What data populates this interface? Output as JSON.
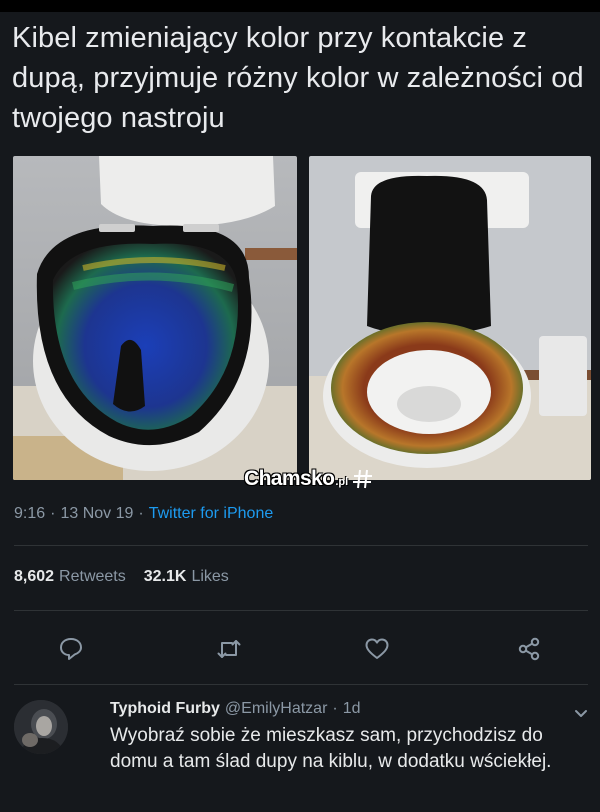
{
  "tweet": {
    "text": "Kibel zmieniający kolor przy kontakcie z dupą, przyjmuje różny kolor w zależności od twojego nastroju"
  },
  "watermark": {
    "main": "Chamsko",
    "tld": ".pl"
  },
  "meta": {
    "time": "9:16",
    "sep1": "·",
    "date": "13 Nov 19",
    "sep2": "·",
    "source": "Twitter for iPhone"
  },
  "stats": {
    "retweets_count": "8,602",
    "retweets_label": "Retweets",
    "likes_count": "32.1K",
    "likes_label": "Likes"
  },
  "icons": {
    "reply": "reply-icon",
    "retweet": "retweet-icon",
    "like": "heart-icon",
    "share": "share-icon",
    "more": "chevron-down-icon"
  },
  "reply": {
    "name": "Typhoid Furby",
    "handle": "@EmilyHatzar",
    "sep": "·",
    "time": "1d",
    "text": "Wyobraź sobie że mieszkasz sam, przychodzisz do domu a tam ślad dupy na kiblu, w dodatku wściekłej."
  },
  "colors": {
    "background": "#15181c",
    "link": "#1d9bf0",
    "muted": "#8b98a5"
  }
}
